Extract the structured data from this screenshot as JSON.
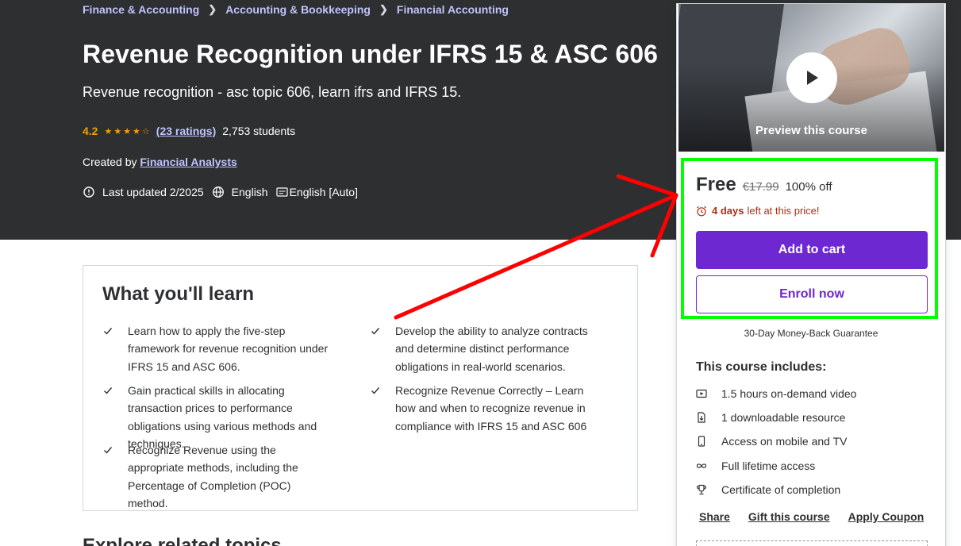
{
  "breadcrumb": [
    "Finance & Accounting",
    "Accounting & Bookkeeping",
    "Financial Accounting"
  ],
  "course": {
    "title": "Revenue Recognition under IFRS 15 & ASC 606",
    "subtitle": "Revenue recognition - asc topic 606, learn ifrs and IFRS 15.",
    "rating": "4.2",
    "stars": "★★★★☆",
    "ratings_link": "(23 ratings)",
    "students": "2,753 students",
    "created_by_label": "Created by",
    "instructor": "Financial Analysts",
    "last_updated": "Last updated 2/2025",
    "language": "English",
    "captions": "English [Auto]"
  },
  "learn": {
    "title": "What you'll learn",
    "items": [
      "Learn how to apply the five-step framework for revenue recognition under IFRS 15 and ASC 606.",
      "Develop the ability to analyze contracts and determine distinct performance obligations in real-world scenarios.",
      "Gain practical skills in allocating transaction prices to performance obligations using various methods and techniques.",
      "Recognize Revenue Correctly – Learn how and when to recognize revenue in compliance with IFRS 15 and ASC 606",
      "Recognize Revenue using the appropriate methods, including the Percentage of Completion (POC) method."
    ]
  },
  "related_title": "Explore related topics",
  "sidebar": {
    "preview_label": "Preview this course",
    "price": "Free",
    "original_price": "€17.99",
    "discount": "100% off",
    "timer_bold": "4 days",
    "timer_rest": "left at this price!",
    "add_to_cart": "Add to cart",
    "enroll_now": "Enroll now",
    "guarantee": "30-Day Money-Back Guarantee",
    "includes_title": "This course includes:",
    "includes": [
      {
        "icon": "video-icon",
        "label": "1.5 hours on-demand video"
      },
      {
        "icon": "download-file-icon",
        "label": "1 downloadable resource"
      },
      {
        "icon": "mobile-icon",
        "label": "Access on mobile and TV"
      },
      {
        "icon": "infinity-icon",
        "label": "Full lifetime access"
      },
      {
        "icon": "trophy-icon",
        "label": "Certificate of completion"
      }
    ],
    "share": "Share",
    "gift": "Gift this course",
    "coupon": "Apply Coupon"
  },
  "colors": {
    "hero_bg": "#2d2f31",
    "link_purple": "#c0c4fc",
    "star": "#f69c08",
    "primary": "#6d28d2",
    "timer_red": "#b32d0f",
    "annotation_green": "#00ff00",
    "annotation_red": "#ff0000"
  }
}
